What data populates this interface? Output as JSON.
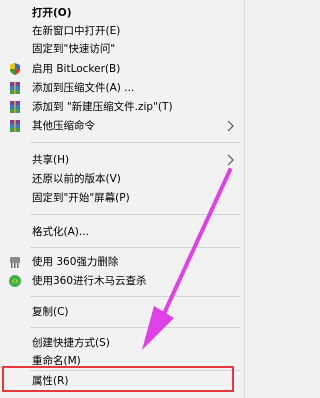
{
  "menu": {
    "open": "打开(O)",
    "open_new_window": "在新窗口中打开(E)",
    "pin_quick_access": "固定到\"快速访问\"",
    "bitlocker": "启用 BitLocker(B)",
    "add_archive": "添加到压缩文件(A) ...",
    "add_zip": "添加到 \"新建压缩文件.zip\"(T)",
    "other_compress": "其他压缩命令",
    "share": "共享(H)",
    "restore": "还原以前的版本(V)",
    "pin_start": "固定到\"开始\"屏幕(P)",
    "format": "格式化(A)...",
    "force_delete": "使用 360强力删除",
    "trojan_scan": "使用360进行木马云查杀",
    "copy": "复制(C)",
    "shortcut": "创建快捷方式(S)",
    "rename": "重命名(M)",
    "properties": "属性(R)"
  },
  "colors": {
    "highlight": "#e8383d",
    "pointer": "#e040e8"
  },
  "icons": {
    "bitlocker": "shield-icon",
    "archive": "winrar-icon",
    "force_delete": "shredder-icon",
    "trojan_scan": "360-icon",
    "submenu": "chevron-right-icon"
  }
}
